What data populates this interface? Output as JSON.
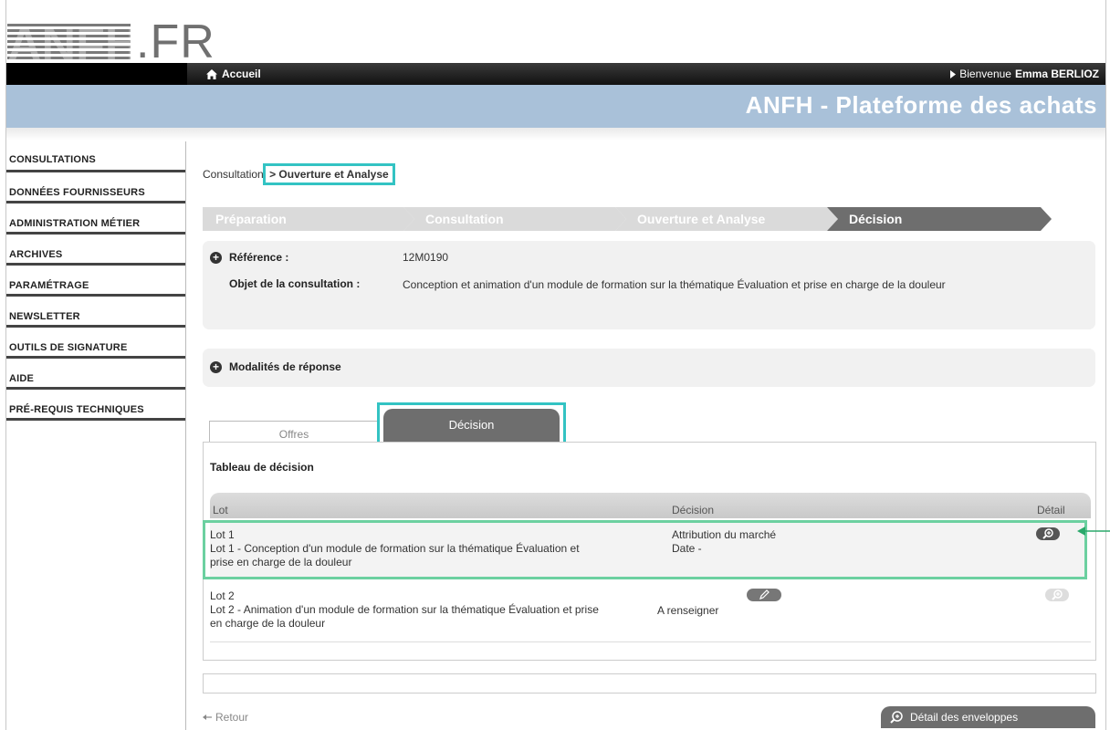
{
  "logo": {
    "text": ".FR"
  },
  "header": {
    "home_label": "Accueil",
    "welcome_prefix": "Bienvenue",
    "user_name": "Emma BERLIOZ",
    "banner_title": "ANFH - Plateforme des achats"
  },
  "sidebar": {
    "items": [
      {
        "label": "CONSULTATIONS"
      },
      {
        "label": "DONNÉES FOURNISSEURS"
      },
      {
        "label": "ADMINISTRATION MÉTIER"
      },
      {
        "label": "ARCHIVES"
      },
      {
        "label": "PARAMÉTRAGE"
      },
      {
        "label": "NEWSLETTER"
      },
      {
        "label": "OUTILS DE SIGNATURE"
      },
      {
        "label": "AIDE"
      },
      {
        "label": "PRÉ-REQUIS TECHNIQUES"
      }
    ]
  },
  "breadcrumb": {
    "root": "Consultation",
    "current": "> Ouverture et Analyse"
  },
  "steps": [
    {
      "label": "Préparation"
    },
    {
      "label": "Consultation"
    },
    {
      "label": "Ouverture et Analyse"
    },
    {
      "label": "Décision"
    }
  ],
  "info": {
    "reference_label": "Référence :",
    "reference_value": "12M0190",
    "object_label": "Objet de la consultation :",
    "object_value": "Conception et animation d'un module de formation sur la thématique Évaluation et prise en charge de la douleur"
  },
  "modalites": {
    "label": "Modalités de réponse"
  },
  "tabs": {
    "offres": "Offres",
    "decision": "Décision"
  },
  "table": {
    "title": "Tableau de décision",
    "columns": {
      "lot": "Lot",
      "decision": "Décision",
      "detail": "Détail"
    },
    "rows": [
      {
        "lot_name": "Lot 1",
        "lot_desc_1": "Lot 1 - Conception d'un module de formation sur la thématique Évaluation et",
        "lot_desc_2": "prise en charge de la douleur",
        "decision_1": "Attribution du marché",
        "decision_2": "Date -"
      },
      {
        "lot_name": "Lot 2",
        "lot_desc_1": "Lot 2 - Animation d'un module de formation sur la thématique Évaluation et prise",
        "lot_desc_2": "en charge de la douleur",
        "decision_1": "A renseigner"
      }
    ]
  },
  "footer": {
    "retour_label": "Retour",
    "envelopes_label": "Détail des enveloppes"
  },
  "colors": {
    "highlight_cyan": "#33c3c3",
    "highlight_green": "#6cd0a0",
    "banner_blue": "#a9c1d9",
    "step_grey": "#dadada",
    "step_active": "#6e6e6e"
  }
}
